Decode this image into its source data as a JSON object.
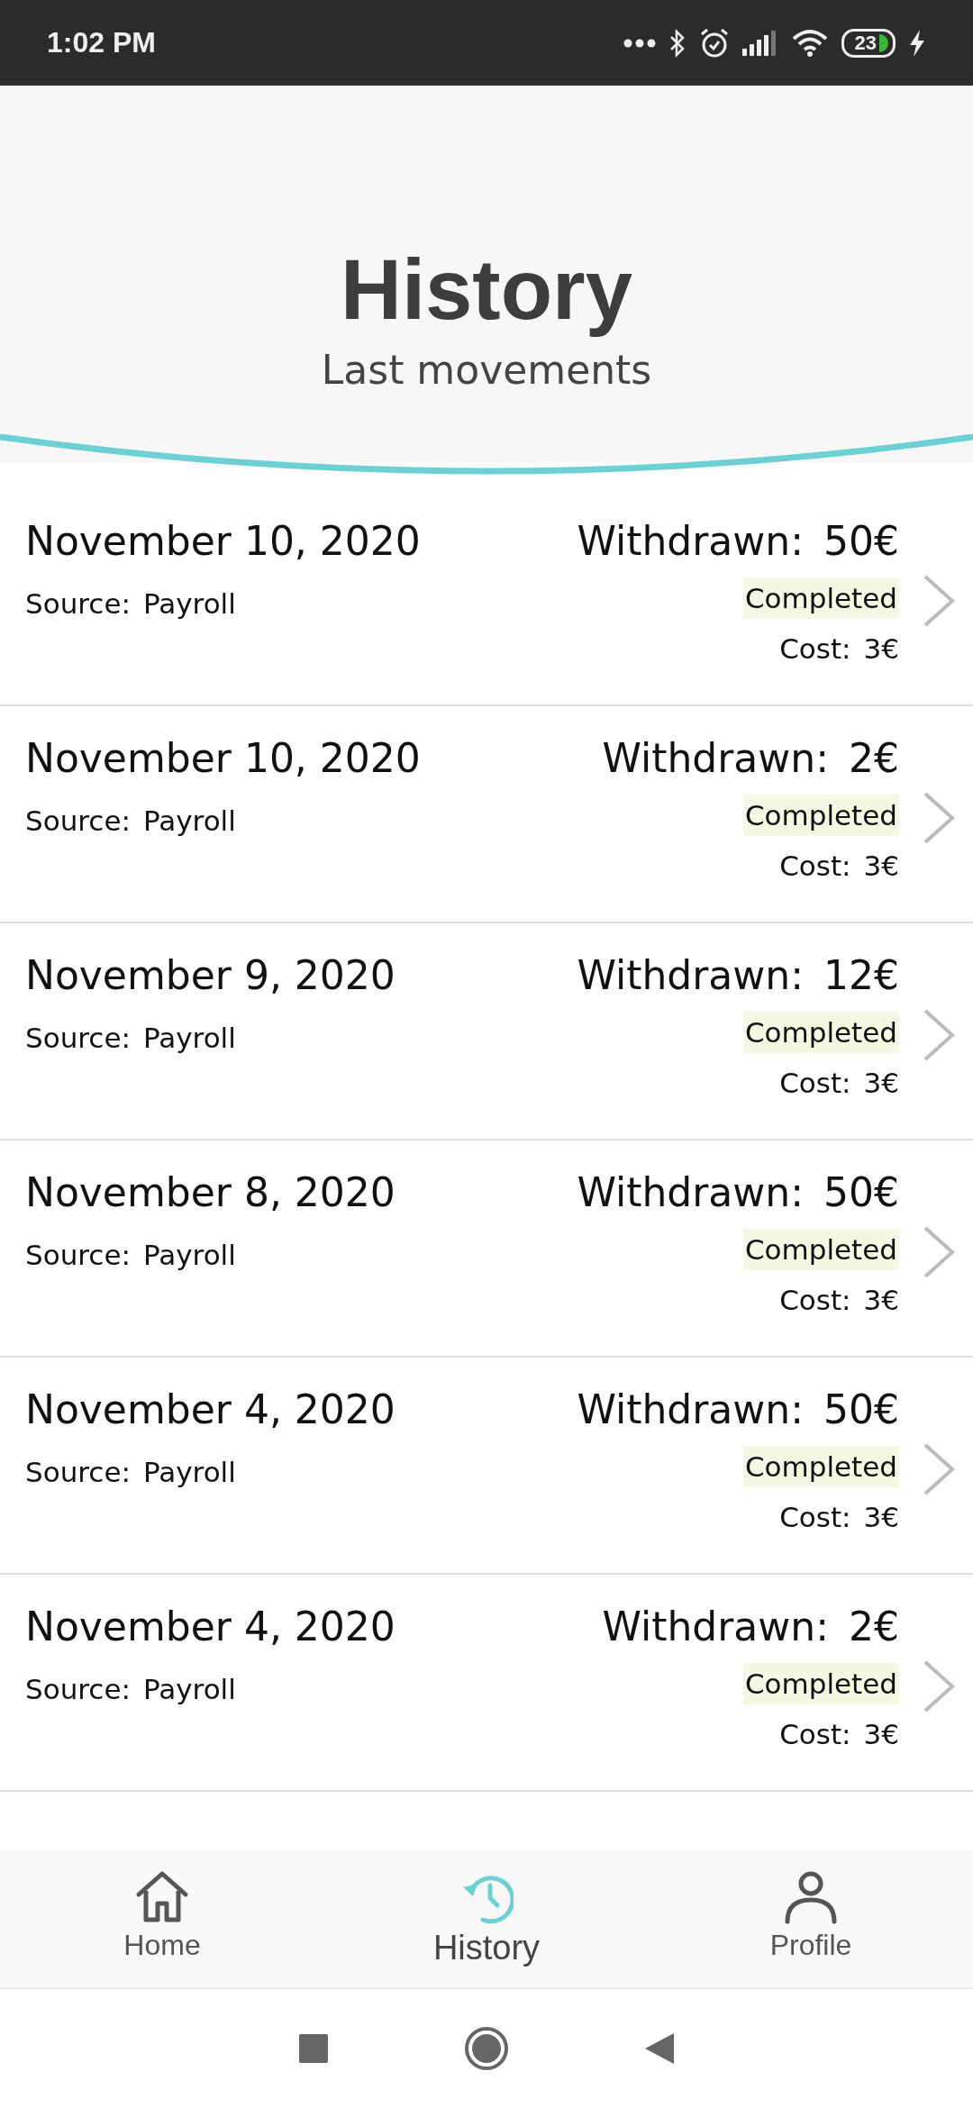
{
  "status_bar": {
    "time": "1:02 PM",
    "battery": "23"
  },
  "header": {
    "title": "History",
    "subtitle": "Last movements"
  },
  "movements": [
    {
      "date": "November 10, 2020",
      "amount_label": "Withdrawn:",
      "amount": "50€",
      "source_label": "Source:",
      "source": "Payroll",
      "status": "Completed",
      "cost_label": "Cost:",
      "cost": "3€"
    },
    {
      "date": "November 10, 2020",
      "amount_label": "Withdrawn:",
      "amount": "2€",
      "source_label": "Source:",
      "source": "Payroll",
      "status": "Completed",
      "cost_label": "Cost:",
      "cost": "3€"
    },
    {
      "date": "November 9, 2020",
      "amount_label": "Withdrawn:",
      "amount": "12€",
      "source_label": "Source:",
      "source": "Payroll",
      "status": "Completed",
      "cost_label": "Cost:",
      "cost": "3€"
    },
    {
      "date": "November 8, 2020",
      "amount_label": "Withdrawn:",
      "amount": "50€",
      "source_label": "Source:",
      "source": "Payroll",
      "status": "Completed",
      "cost_label": "Cost:",
      "cost": "3€"
    },
    {
      "date": "November 4, 2020",
      "amount_label": "Withdrawn:",
      "amount": "50€",
      "source_label": "Source:",
      "source": "Payroll",
      "status": "Completed",
      "cost_label": "Cost:",
      "cost": "3€"
    },
    {
      "date": "November 4, 2020",
      "amount_label": "Withdrawn:",
      "amount": "2€",
      "source_label": "Source:",
      "source": "Payroll",
      "status": "Completed",
      "cost_label": "Cost:",
      "cost": "3€"
    }
  ],
  "bottom_nav": [
    {
      "kind": "home",
      "label": "Home",
      "selected": false
    },
    {
      "kind": "history",
      "label": "History",
      "selected": true
    },
    {
      "kind": "profile",
      "label": "Profile",
      "selected": false
    }
  ]
}
